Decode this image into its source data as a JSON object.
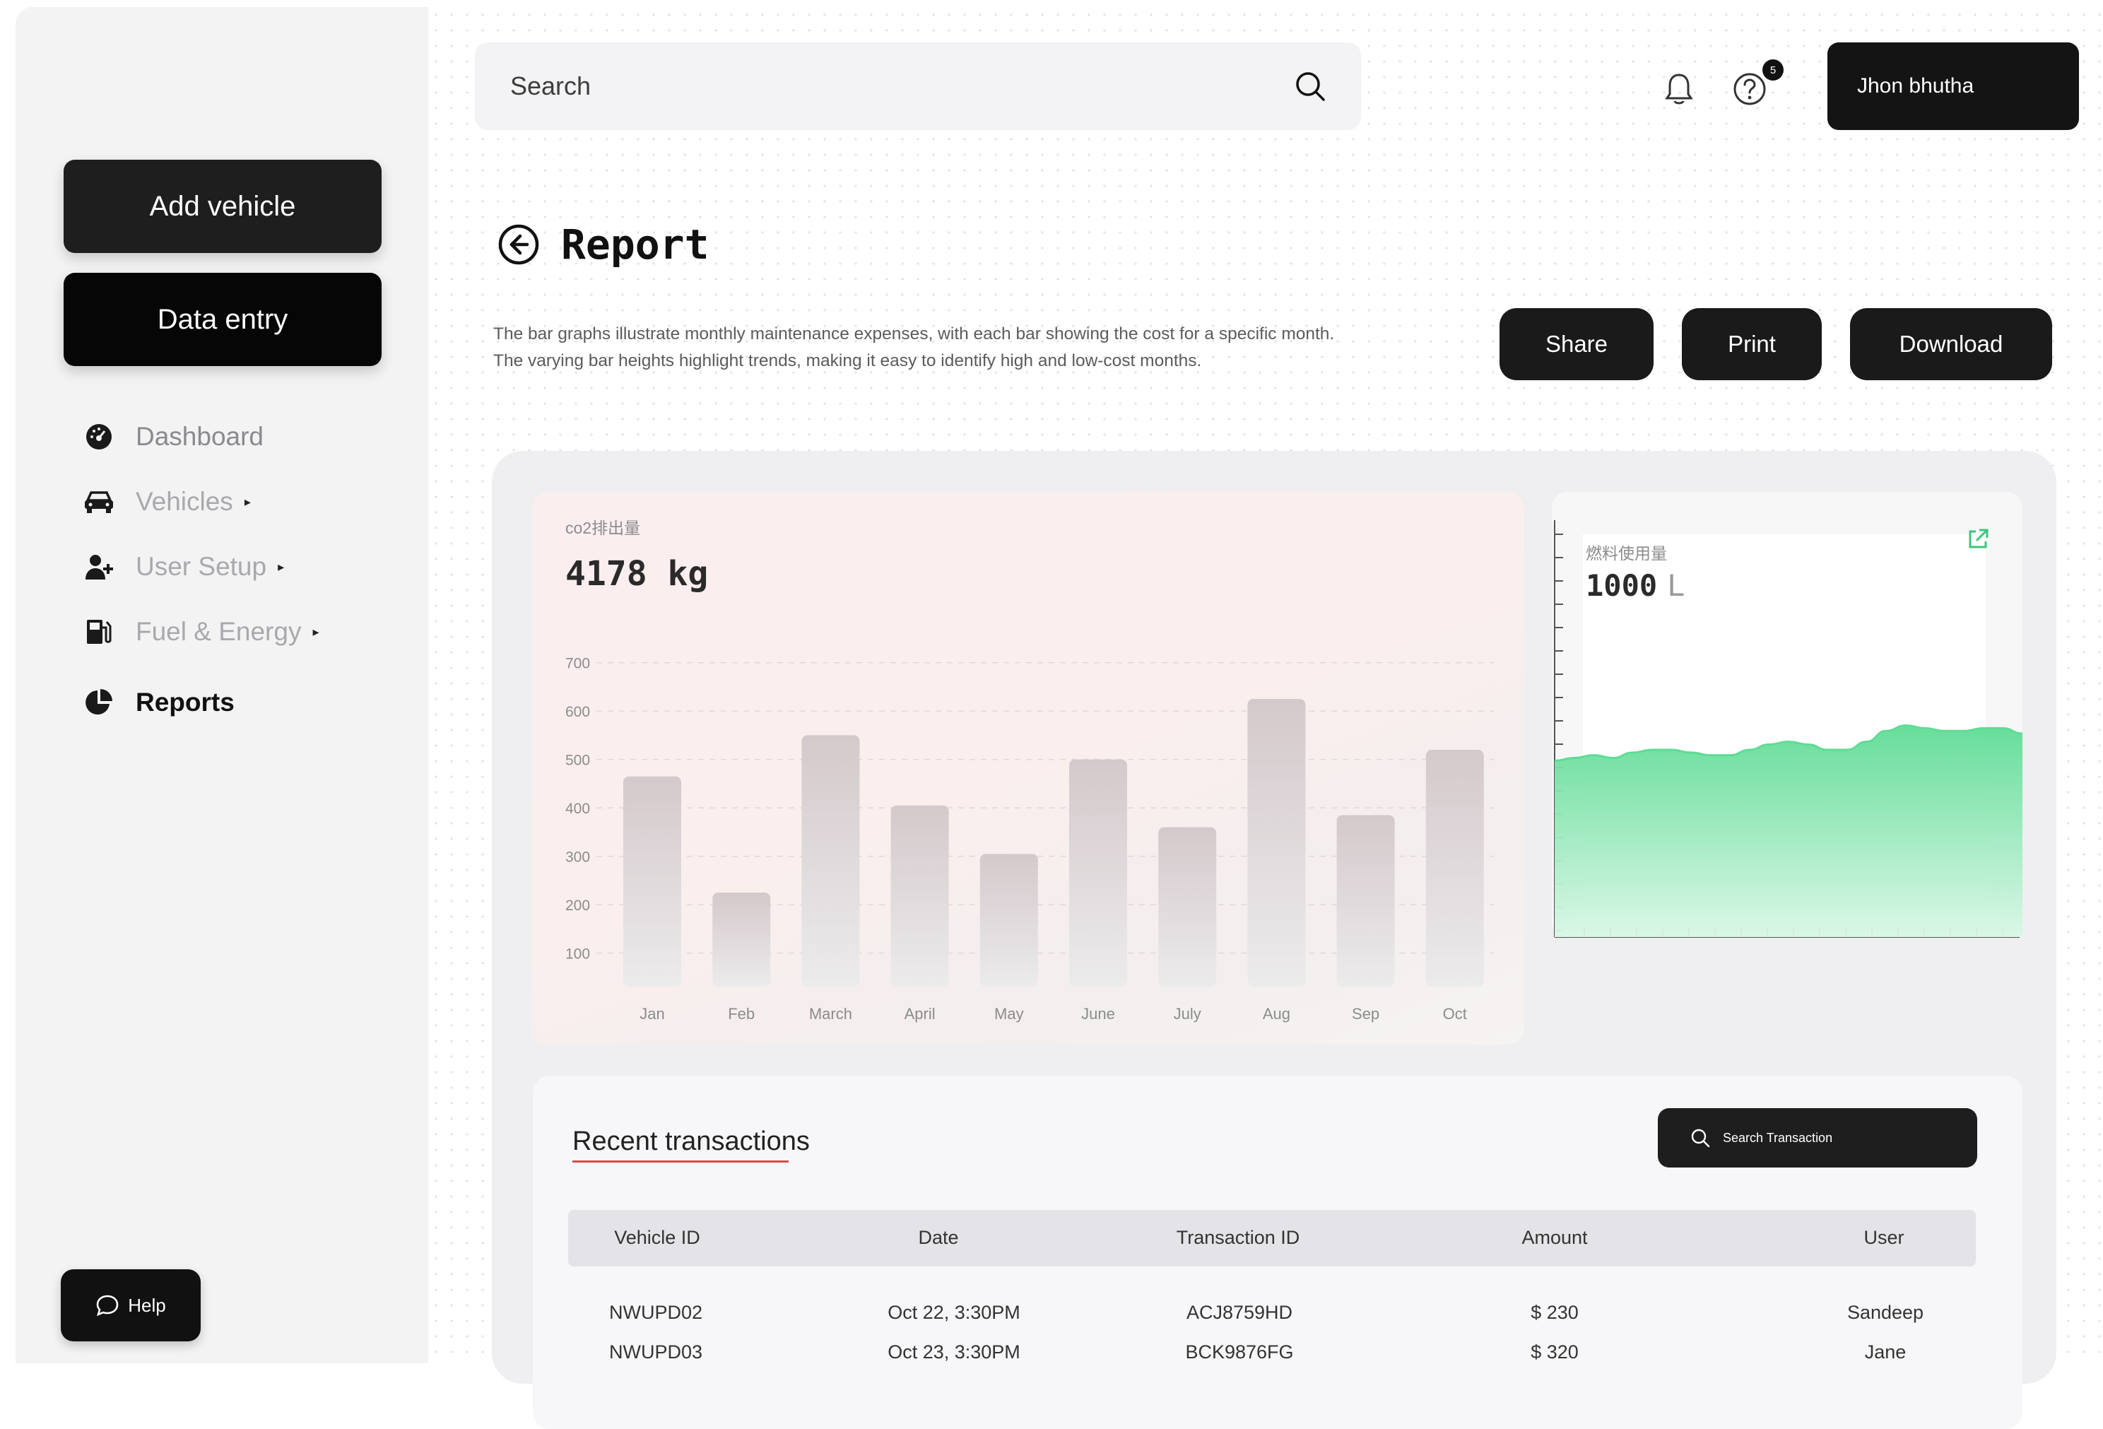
{
  "sidebar": {
    "add_vehicle": "Add vehicle",
    "data_entry": "Data entry",
    "nav": [
      {
        "label": "Dashboard",
        "icon": "dashboard-gauge-icon"
      },
      {
        "label": "Vehicles",
        "icon": "car-icon",
        "caret": "▸"
      },
      {
        "label": "User Setup",
        "icon": "user-add-icon",
        "caret": "▸"
      },
      {
        "label": "Fuel & Energy",
        "icon": "fuel-pump-icon",
        "caret": "▸"
      },
      {
        "label": "Reports",
        "icon": "pie-chart-icon"
      }
    ],
    "help": "Help"
  },
  "header": {
    "search_placeholder": "Search",
    "notification_count": "5",
    "user_name": "Jhon bhutha"
  },
  "report": {
    "title": "Report",
    "description": "The bar graphs illustrate monthly maintenance expenses, with each bar showing the cost for a specific month. The varying bar heights highlight trends, making it easy to identify high and low-cost months.",
    "share": "Share",
    "print": "Print",
    "download": "Download"
  },
  "co2_card": {
    "label": "co2排出量",
    "value": "4178",
    "unit": "kg"
  },
  "fuel_card": {
    "label": "燃料使用量",
    "value": "1000",
    "unit": "L"
  },
  "chart_data": [
    {
      "type": "bar",
      "categories": [
        "Jan",
        "Feb",
        "March",
        "April",
        "May",
        "June",
        "July",
        "Aug",
        "Sep",
        "Oct"
      ],
      "values": [
        465,
        225,
        550,
        405,
        305,
        500,
        360,
        625,
        385,
        520
      ],
      "yticks": [
        100,
        200,
        300,
        400,
        500,
        600,
        700
      ],
      "ylim": [
        60,
        720
      ],
      "title": "",
      "xlabel": "",
      "ylabel": ""
    },
    {
      "type": "area",
      "values": [
        0.6,
        0.61,
        0.62,
        0.61,
        0.63,
        0.64,
        0.64,
        0.63,
        0.62,
        0.62,
        0.64,
        0.66,
        0.67,
        0.66,
        0.64,
        0.64,
        0.67,
        0.71,
        0.73,
        0.72,
        0.71,
        0.71,
        0.72,
        0.72,
        0.7
      ],
      "color": "#5fdc95",
      "ylim": [
        0,
        1
      ]
    }
  ],
  "transactions": {
    "title": "Recent transactions",
    "search_placeholder": "Search Transaction",
    "columns": [
      "Vehicle ID",
      "Date",
      "Transaction ID",
      "Amount",
      "User"
    ],
    "rows": [
      [
        "NWUPD02",
        "Oct 22, 3:30PM",
        "ACJ8759HD",
        "$ 230",
        "Sandeep"
      ],
      [
        "NWUPD03",
        "Oct 23, 3:30PM",
        "BCK9876FG",
        "$ 320",
        "Jane"
      ]
    ]
  },
  "colors": {
    "accent_dark": "#1a1a1a",
    "underline": "#d94a4a",
    "area_green": "#5fdc95"
  }
}
